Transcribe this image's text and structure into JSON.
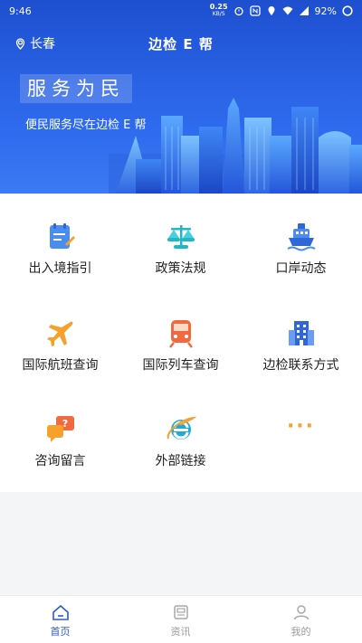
{
  "status_bar": {
    "time": "9:46",
    "net_speed": "0.25",
    "net_unit": "KB/S",
    "battery": "92%"
  },
  "header": {
    "location": "长春",
    "title": "边检 E 帮"
  },
  "banner": {
    "slogan": "服务为民",
    "subtitle": "便民服务尽在边检 E 帮"
  },
  "services": [
    {
      "label": "出入境指引",
      "icon": "guide-icon"
    },
    {
      "label": "政策法规",
      "icon": "scale-icon"
    },
    {
      "label": "口岸动态",
      "icon": "ship-icon"
    },
    {
      "label": "国际航班查询",
      "icon": "airplane-icon"
    },
    {
      "label": "国际列车查询",
      "icon": "train-icon"
    },
    {
      "label": "边检联系方式",
      "icon": "building-icon"
    },
    {
      "label": "咨询留言",
      "icon": "chat-icon"
    },
    {
      "label": "外部链接",
      "icon": "browser-icon"
    },
    {
      "label": "",
      "icon": "more-icon",
      "dots": "···"
    }
  ],
  "tabs": [
    {
      "label": "首页",
      "icon": "home-icon",
      "active": true
    },
    {
      "label": "资讯",
      "icon": "news-icon",
      "active": false
    },
    {
      "label": "我的",
      "icon": "user-icon",
      "active": false
    }
  ],
  "colors": {
    "primary": "#2a63e6",
    "accent_orange": "#f5a12b",
    "active_tab": "#2f5bcc"
  }
}
